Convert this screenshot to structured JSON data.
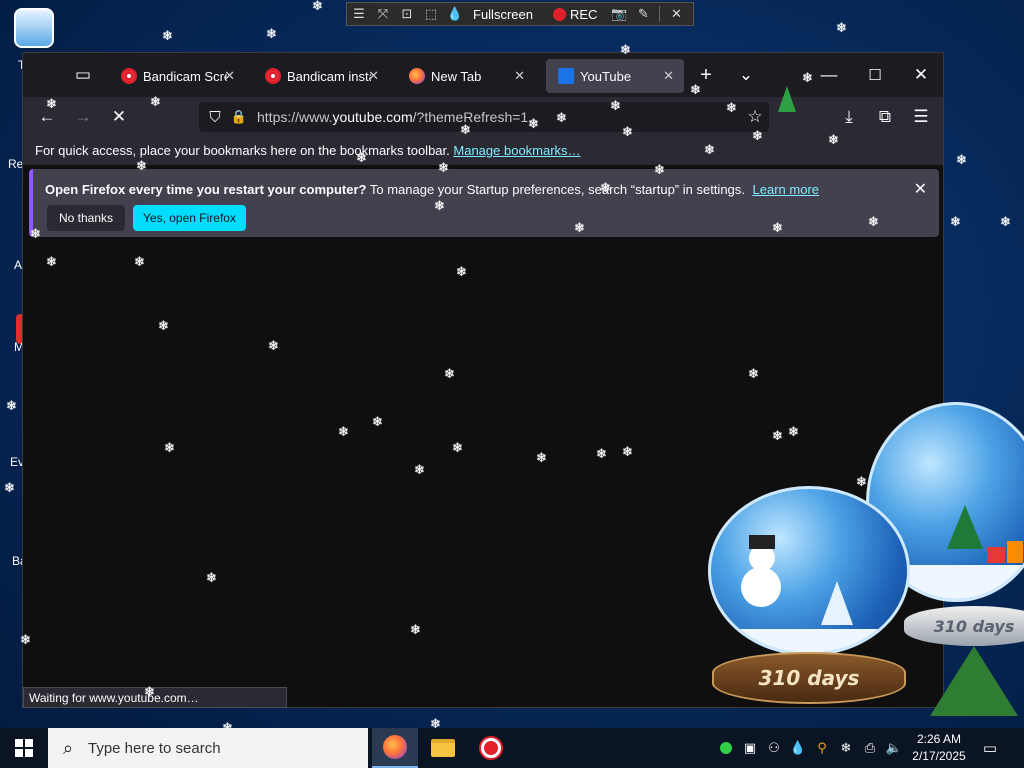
{
  "desktop": {
    "icons": [
      {
        "label": "T"
      },
      {
        "label": "Re"
      },
      {
        "label": "A"
      },
      {
        "label": "M"
      },
      {
        "label": "Ev"
      },
      {
        "label": "Ba"
      }
    ]
  },
  "bandicam": {
    "fullscreen_label": "Fullscreen",
    "rec_label": "REC"
  },
  "browser": {
    "tabs": [
      {
        "title": "Bandicam Scree",
        "icon": "bandicam-icon",
        "active": false
      },
      {
        "title": "Bandicam insta",
        "icon": "bandicam-icon",
        "active": false
      },
      {
        "title": "New Tab",
        "icon": "firefox-icon",
        "active": false
      },
      {
        "title": "YouTube",
        "icon": "youtube-loading-icon",
        "active": true
      }
    ],
    "url": {
      "prefix": "https://www.",
      "host": "youtube.com",
      "suffix": "/?themeRefresh=1"
    },
    "bookmarks_bar": {
      "text": "For quick access, place your bookmarks here on the bookmarks toolbar.",
      "link": "Manage bookmarks…"
    },
    "infobar": {
      "bold": "Open Firefox every time you restart your computer?",
      "text": "To manage your Startup preferences, search “startup” in settings.",
      "link": "Learn more",
      "no_thanks": "No thanks",
      "yes_open": "Yes, open Firefox"
    },
    "status": "Waiting for www.youtube.com…"
  },
  "widgets": {
    "globe_left_label": "310 days",
    "globe_right_label": "310 days"
  },
  "taskbar": {
    "search_placeholder": "Type here to search",
    "time": "2:26 AM",
    "date": "2/17/2025"
  },
  "colors": {
    "accent": "#00ddff",
    "link": "#80ebff",
    "record": "#e0212b"
  }
}
